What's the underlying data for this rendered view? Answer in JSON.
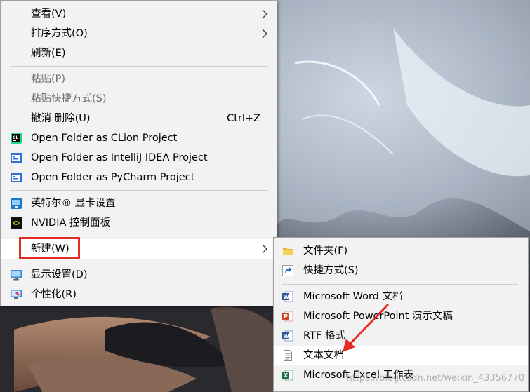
{
  "context_menu": {
    "items": [
      {
        "label": "查看(V)",
        "disabled": false
      },
      {
        "label": "排序方式(O)",
        "disabled": false
      },
      {
        "label": "刷新(E)",
        "disabled": false
      },
      {
        "label": "粘贴(P)",
        "disabled": true
      },
      {
        "label": "粘贴快捷方式(S)",
        "disabled": true
      },
      {
        "label": "撤消 删除(U)",
        "shortcut": "Ctrl+Z",
        "disabled": false
      },
      {
        "label": "Open Folder as CLion Project",
        "icon": "clion-icon"
      },
      {
        "label": "Open Folder as IntelliJ IDEA Project",
        "icon": "intellij-idea-icon"
      },
      {
        "label": "Open Folder as PyCharm Project",
        "icon": "pycharm-icon"
      },
      {
        "label": "英特尔® 显卡设置",
        "icon": "intel-graphics-icon"
      },
      {
        "label": "NVIDIA 控制面板",
        "icon": "nvidia-icon"
      },
      {
        "label": "新建(W)",
        "highlighted": true
      },
      {
        "label": "显示设置(D)",
        "icon": "display-settings-icon"
      },
      {
        "label": "个性化(R)",
        "icon": "personalize-icon"
      }
    ]
  },
  "new_submenu": {
    "items": [
      {
        "label": "文件夹(F)",
        "icon": "folder-icon"
      },
      {
        "label": "快捷方式(S)",
        "icon": "shortcut-icon"
      },
      {
        "label": "Microsoft Word 文档",
        "icon": "word-document-icon"
      },
      {
        "label": "Microsoft PowerPoint 演示文稿",
        "icon": "powerpoint-icon"
      },
      {
        "label": "RTF 格式",
        "icon": "rtf-document-icon"
      },
      {
        "label": "文本文档",
        "icon": "text-document-icon",
        "hovered": true
      },
      {
        "label": "Microsoft Excel 工作表",
        "icon": "excel-icon"
      }
    ]
  },
  "watermark": "https://blog.csdn.net/weixin_43356770",
  "colors": {
    "menu_bg": "#f2f2f2",
    "hover_bg": "#ffffff",
    "highlight_red": "#e52b26",
    "disabled_text": "#6d6d6d"
  }
}
